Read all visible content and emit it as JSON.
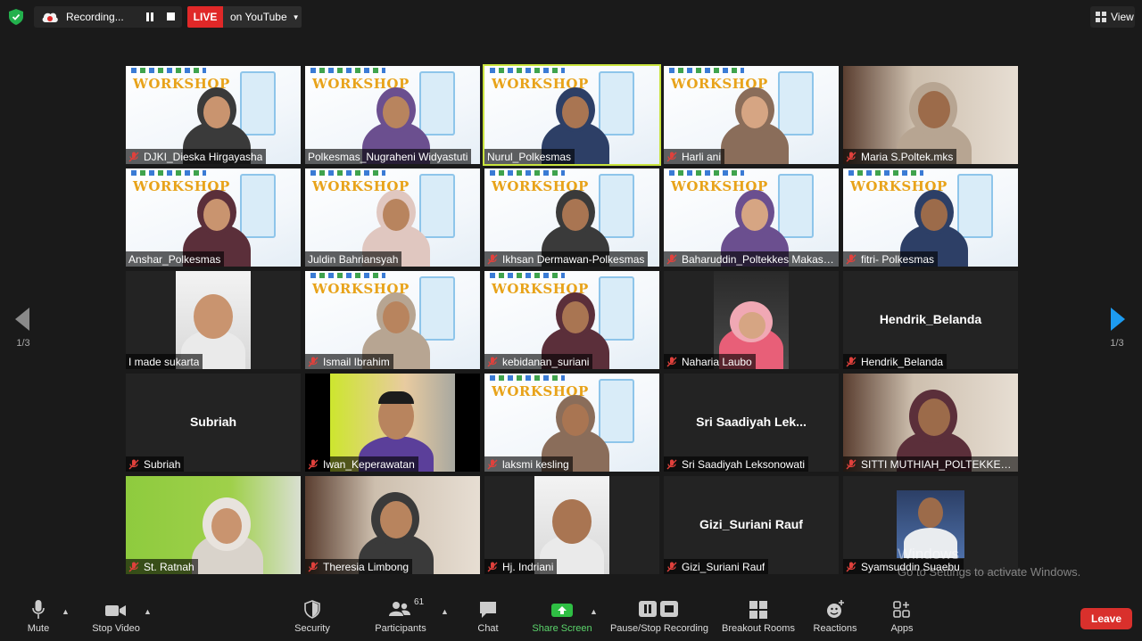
{
  "topbar": {
    "recording_label": "Recording...",
    "live_label": "LIVE",
    "youtube_label": "on YouTube",
    "view_label": "View"
  },
  "navigation": {
    "left_page": "1/3",
    "right_page": "1/3"
  },
  "participants_grid": [
    {
      "name": "DJKI_Dieska Hirgayasha",
      "muted": true,
      "video": "workshop"
    },
    {
      "name": "Polkesmas_Nugraheni Widyastuti",
      "muted": false,
      "video": "workshop"
    },
    {
      "name": "Nurul_Polkesmas",
      "muted": false,
      "video": "workshop",
      "active_speaker": true
    },
    {
      "name": "Harli ani",
      "muted": true,
      "video": "workshop"
    },
    {
      "name": "Maria S.Poltek.mks",
      "muted": true,
      "video": "room"
    },
    {
      "name": "Anshar_Polkesmas",
      "muted": false,
      "video": "workshop"
    },
    {
      "name": "Juldin Bahriansyah",
      "muted": false,
      "video": "workshop"
    },
    {
      "name": "Ikhsan Dermawan-Polkesmas",
      "muted": true,
      "video": "workshop"
    },
    {
      "name": "Baharuddin_Poltekkes Makass...",
      "muted": true,
      "video": "workshop"
    },
    {
      "name": "fitri- Polkesmas",
      "muted": true,
      "video": "workshop"
    },
    {
      "name": "I made sukarta",
      "muted": false,
      "video": "portrait"
    },
    {
      "name": "Ismail Ibrahim",
      "muted": true,
      "video": "workshop"
    },
    {
      "name": "kebidanan_suriani",
      "muted": true,
      "video": "workshop"
    },
    {
      "name": "Naharia Laubo",
      "muted": true,
      "video": "car"
    },
    {
      "name": "Hendrik_Belanda",
      "muted": true,
      "video": "none",
      "display_name": "Hendrik_Belanda"
    },
    {
      "name": "Subriah",
      "muted": true,
      "video": "none",
      "display_name": "Subriah"
    },
    {
      "name": "Iwan_Keperawatan",
      "muted": true,
      "video": "green-room"
    },
    {
      "name": "laksmi kesling",
      "muted": true,
      "video": "workshop"
    },
    {
      "name": "Sri Saadiyah Leksonowati",
      "muted": true,
      "video": "none",
      "display_name": "Sri  Saadiyah  Lek..."
    },
    {
      "name": "SITTI  MUTHIAH_POLTEKKES ...",
      "muted": true,
      "video": "room"
    },
    {
      "name": "St. Ratnah",
      "muted": true,
      "video": "green-wall"
    },
    {
      "name": "Theresia Limbong",
      "muted": true,
      "video": "room"
    },
    {
      "name": "Hj. Indriani",
      "muted": true,
      "video": "portrait"
    },
    {
      "name": "Gizi_Suriani Rauf",
      "muted": true,
      "video": "none",
      "display_name": "Gizi_Suriani Rauf"
    },
    {
      "name": "Syamsuddin Suaebu",
      "muted": true,
      "video": "photo"
    }
  ],
  "workshop_banner": {
    "title": "WORKSHOP"
  },
  "watermark": {
    "line1": "Windows",
    "line2": "Go to Settings to activate Windows."
  },
  "toolbar": {
    "mute": "Mute",
    "stop_video": "Stop Video",
    "security": "Security",
    "participants": "Participants",
    "participants_count": "61",
    "chat": "Chat",
    "share_screen": "Share Screen",
    "pause_stop_recording": "Pause/Stop Recording",
    "breakout_rooms": "Breakout Rooms",
    "reactions": "Reactions",
    "apps": "Apps",
    "leave": "Leave"
  },
  "colors": {
    "background": "#1a1a1a",
    "tile": "#232323",
    "live_red": "#e02828",
    "leave_red": "#d9302c",
    "share_green": "#2fbf44",
    "active_speaker": "#c9e33d",
    "muted_red": "#e0413c"
  }
}
